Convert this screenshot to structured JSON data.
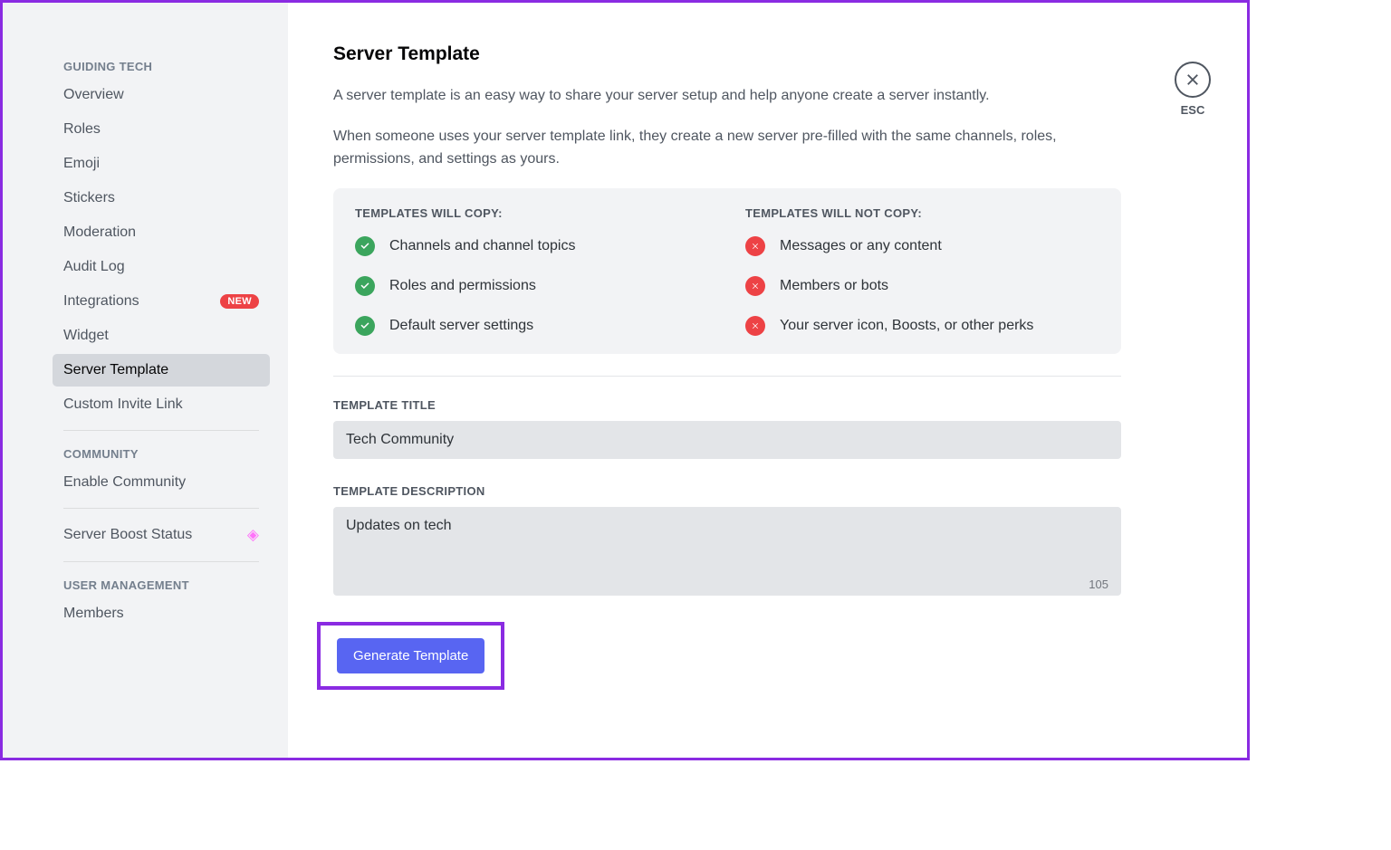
{
  "sidebar": {
    "section1_header": "Guiding Tech",
    "items1": [
      "Overview",
      "Roles",
      "Emoji",
      "Stickers",
      "Moderation",
      "Audit Log",
      "Integrations",
      "Widget",
      "Server Template",
      "Custom Invite Link"
    ],
    "new_badge": "NEW",
    "section2_header": "Community",
    "items2": [
      "Enable Community"
    ],
    "boost_label": "Server Boost Status",
    "section3_header": "User Management",
    "items3": [
      "Members"
    ]
  },
  "main": {
    "title": "Server Template",
    "desc1": "A server template is an easy way to share your server setup and help anyone create a server instantly.",
    "desc2": "When someone uses your server template link, they create a new server pre-filled with the same channels, roles, permissions, and settings as yours.",
    "copy_header": "Templates will copy:",
    "nocopy_header": "Templates will not copy:",
    "copy_items": [
      "Channels and channel topics",
      "Roles and permissions",
      "Default server settings"
    ],
    "nocopy_items": [
      "Messages or any content",
      "Members or bots",
      "Your server icon, Boosts, or other perks"
    ],
    "title_label": "Template Title",
    "title_value": "Tech Community",
    "desc_label": "Template Description",
    "desc_value": "Updates on tech",
    "char_count": "105",
    "generate_btn": "Generate Template",
    "esc_label": "ESC"
  }
}
